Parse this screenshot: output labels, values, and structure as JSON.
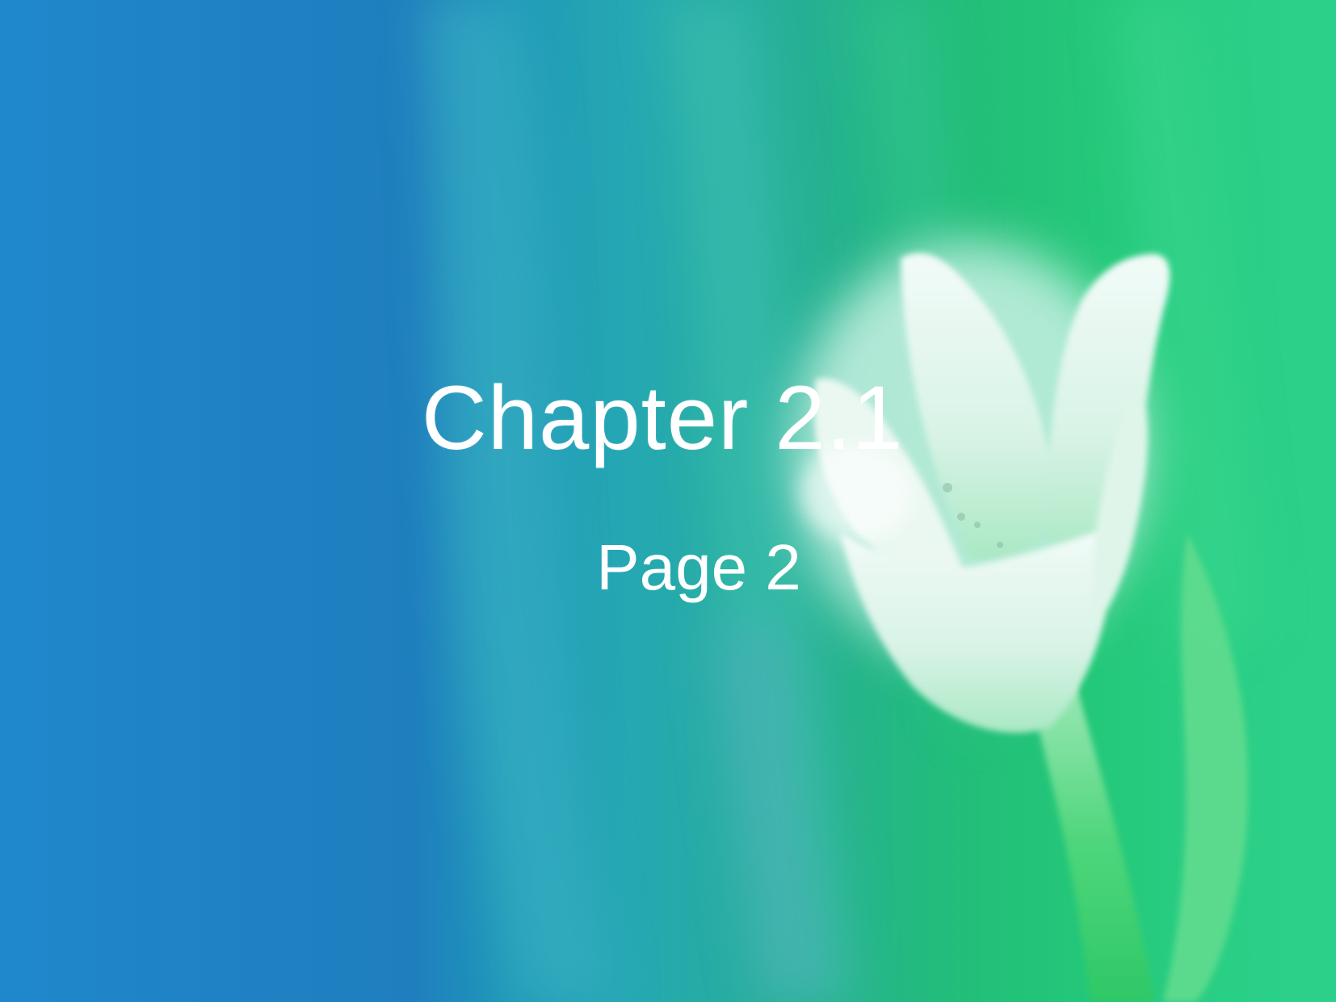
{
  "slide": {
    "title": "Chapter 2.1",
    "subtitle": "Page 2"
  },
  "background": {
    "description_colors": {
      "left": "#1f88cc",
      "middle": "#25a8b3",
      "right": "#24c879",
      "flower": "#e6f7f0"
    },
    "icon": "white-lily-flower"
  }
}
